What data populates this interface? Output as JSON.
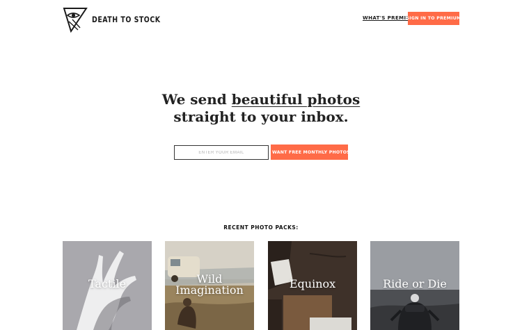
{
  "brand": {
    "name": "DEATH TO STOCK"
  },
  "nav": {
    "premium_link": "WHAT'S PREMIUM?",
    "signin_label": "SIGN IN TO PREMIUM"
  },
  "hero": {
    "line1_prefix": "We send ",
    "line1_link": "beautiful photos",
    "line2": "straight to your inbox."
  },
  "signup": {
    "email_placeholder": "ENTER YOUR EMAIL",
    "cta_label": "I WANT FREE MONTHLY PHOTOS"
  },
  "packs": {
    "title": "RECENT PHOTO PACKS:",
    "items": [
      {
        "label": "Tactile"
      },
      {
        "label": "Wild Imagination"
      },
      {
        "label": "Equinox"
      },
      {
        "label": "Ride or Die"
      }
    ]
  },
  "colors": {
    "accent": "#ff6b47",
    "text": "#1a1a1a",
    "background": "#ffffff"
  }
}
